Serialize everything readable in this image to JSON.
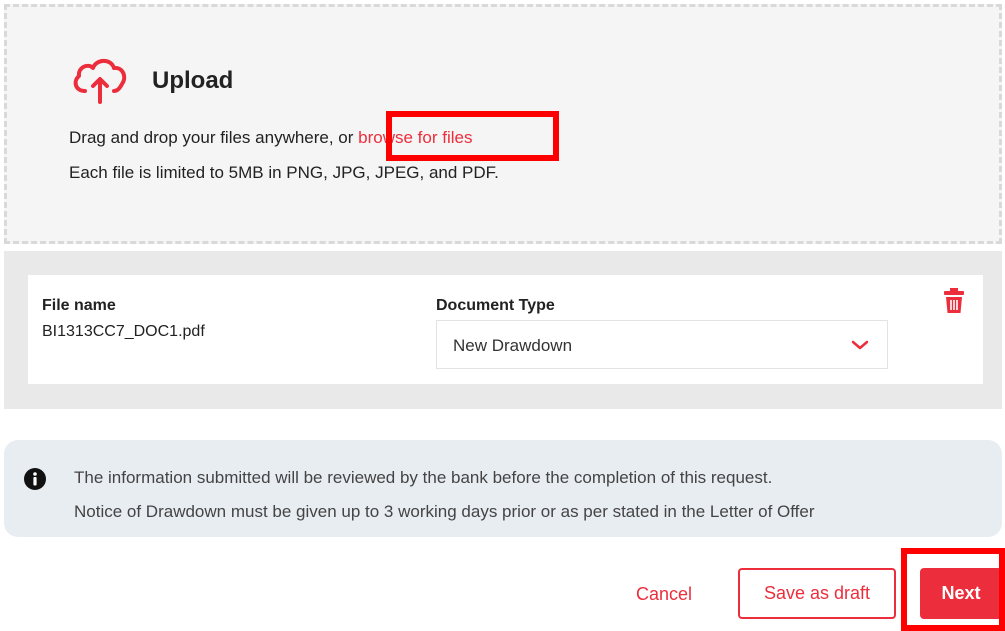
{
  "upload": {
    "title": "Upload",
    "line1_prefix": "Drag and drop your files anywhere, or ",
    "browse_link": "browse for files",
    "line2": "Each file is limited to 5MB in PNG, JPG, JPEG, and PDF.",
    "icon": "cloud-upload-icon"
  },
  "file": {
    "name_label": "File name",
    "name_value": "BI1313CC7_DOC1.pdf",
    "doc_type_label": "Document Type",
    "doc_type_value": "New Drawdown",
    "delete_icon": "trash-icon"
  },
  "info": {
    "line1": "The information submitted will be reviewed by the bank before the completion of this request.",
    "line2": "Notice of Drawdown must be given up to 3 working days prior or as per stated in the Letter of Offer"
  },
  "actions": {
    "cancel": "Cancel",
    "save_draft": "Save as draft",
    "next": "Next"
  },
  "colors": {
    "accent": "#ec2e3c",
    "highlight": "#ff0000",
    "info_bg": "#e8edf2"
  }
}
